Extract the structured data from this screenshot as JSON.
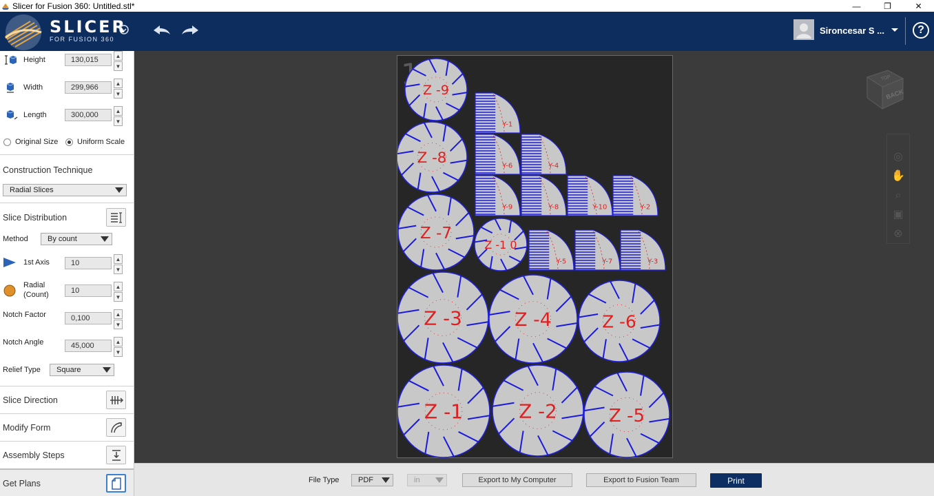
{
  "window": {
    "title": "Slicer for Fusion 360: Untitled.stl*",
    "controls": {
      "minimize": "—",
      "restore": "❐",
      "close": "✕"
    }
  },
  "header": {
    "logo_word": "SLICER",
    "logo_sub": "FOR FUSION 360",
    "user_name": "Sironcesar S ...",
    "help": "?",
    "colors": {
      "header_bg": "#0d2d5e",
      "accent": "#0c2e63"
    }
  },
  "sidebar": {
    "dimensions": [
      {
        "label": "Height",
        "value": "130,015"
      },
      {
        "label": "Width",
        "value": "299,966"
      },
      {
        "label": "Length",
        "value": "300,000"
      }
    ],
    "scale_options": [
      {
        "label": "Original Size",
        "selected": false
      },
      {
        "label": "Uniform Scale",
        "selected": true
      }
    ],
    "construction": {
      "title": "Construction Technique",
      "selected": "Radial Slices"
    },
    "distribution": {
      "title": "Slice Distribution",
      "method_label": "Method",
      "method_value": "By count",
      "axis1_label": "1st Axis",
      "axis1_value": "10",
      "radial_label_1": "Radial",
      "radial_label_2": "(Count)",
      "radial_value": "10",
      "notch_factor_label": "Notch Factor",
      "notch_factor_value": "0,100",
      "notch_angle_label": "Notch Angle",
      "notch_angle_value": "45,000",
      "relief_label": "Relief Type",
      "relief_value": "Square"
    },
    "sections": [
      {
        "title": "Slice Direction"
      },
      {
        "title": "Modify Form"
      },
      {
        "title": "Assembly Steps"
      },
      {
        "title": "Get Plans"
      }
    ]
  },
  "viewport": {
    "sheet_number": "1",
    "viewcube_labels": {
      "top": "TOP",
      "back": "BACK"
    },
    "radial_parts": [
      {
        "label": "Z-9"
      },
      {
        "label": "Z-8"
      },
      {
        "label": "Z-7"
      },
      {
        "label": "Z-10"
      },
      {
        "label": "Z-3"
      },
      {
        "label": "Z-4"
      },
      {
        "label": "Z-6"
      },
      {
        "label": "Z-1"
      },
      {
        "label": "Z-2"
      },
      {
        "label": "Z-5"
      }
    ],
    "quarter_parts": [
      {
        "label": "Y-1"
      },
      {
        "label": "Y-6"
      },
      {
        "label": "Y-4"
      },
      {
        "label": "Y-9"
      },
      {
        "label": "Y-8"
      },
      {
        "label": "Y-10"
      },
      {
        "label": "Y-2"
      },
      {
        "label": "Y-5"
      },
      {
        "label": "Y-7"
      },
      {
        "label": "Y-3"
      }
    ]
  },
  "footer": {
    "file_type_label": "File Type",
    "file_type_value": "PDF",
    "unit_value": "in",
    "export_computer": "Export to My Computer",
    "export_team": "Export to Fusion Team",
    "print": "Print"
  }
}
